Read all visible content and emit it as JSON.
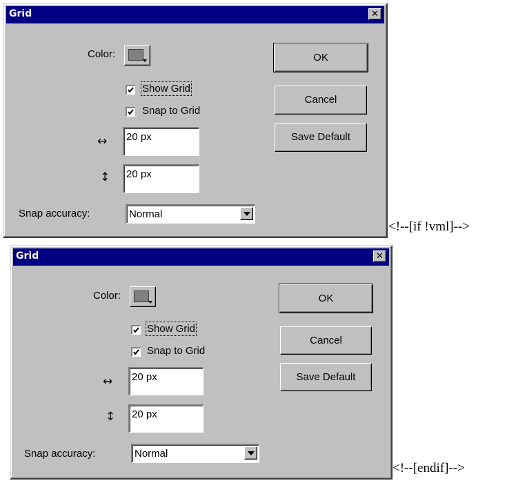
{
  "dialogs": [
    {
      "title": "Grid",
      "close_glyph": "✕",
      "color_label": "Color:",
      "color_value": "#808080",
      "show_grid": {
        "label": "Show Grid",
        "checked": true
      },
      "snap_to_grid": {
        "label": "Snap to Grid",
        "checked": true
      },
      "horizontal_icon": "↔",
      "horizontal_value": "20 px",
      "vertical_icon": "↕",
      "vertical_value": "20 px",
      "snap_accuracy_label": "Snap accuracy:",
      "snap_accuracy_value": "Normal",
      "buttons": {
        "ok": "OK",
        "cancel": "Cancel",
        "save_default": "Save Default"
      }
    },
    {
      "title": "Grid",
      "close_glyph": "✕",
      "color_label": "Color:",
      "color_value": "#808080",
      "show_grid": {
        "label": "Show Grid",
        "checked": true
      },
      "snap_to_grid": {
        "label": "Snap to Grid",
        "checked": true
      },
      "horizontal_icon": "↔",
      "horizontal_value": "20 px",
      "vertical_icon": "↕",
      "vertical_value": "20 px",
      "snap_accuracy_label": "Snap accuracy:",
      "snap_accuracy_value": "Normal",
      "buttons": {
        "ok": "OK",
        "cancel": "Cancel",
        "save_default": "Save Default"
      }
    }
  ],
  "comments": {
    "first": "<!--[if !vml]-->",
    "second": "<!--[endif]-->"
  }
}
